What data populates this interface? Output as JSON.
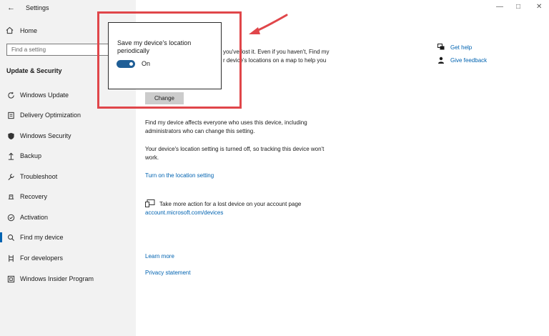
{
  "window": {
    "title": "Settings",
    "back_glyph": "←",
    "minimize_glyph": "—",
    "maximize_glyph": "□",
    "close_glyph": "✕"
  },
  "sidebar": {
    "home_label": "Home",
    "search_placeholder": "Find a setting",
    "section_title": "Update & Security",
    "items": [
      {
        "label": "Windows Update",
        "icon": "sync-icon"
      },
      {
        "label": "Delivery Optimization",
        "icon": "delivery-icon"
      },
      {
        "label": "Windows Security",
        "icon": "shield-icon"
      },
      {
        "label": "Backup",
        "icon": "backup-icon"
      },
      {
        "label": "Troubleshoot",
        "icon": "wrench-icon"
      },
      {
        "label": "Recovery",
        "icon": "recovery-icon"
      },
      {
        "label": "Activation",
        "icon": "activation-icon"
      },
      {
        "label": "Find my device",
        "icon": "find-device-icon",
        "active": true
      },
      {
        "label": "For developers",
        "icon": "developer-icon"
      },
      {
        "label": "Windows Insider Program",
        "icon": "insider-icon"
      }
    ]
  },
  "main": {
    "intro_line1": "you've lost it. Even if you haven't, Find my",
    "intro_line2": "r device's locations on a map to help you",
    "change_button": "Change",
    "affects_line1": "Find my device affects everyone who uses this device, including",
    "affects_line2": "administrators who can change this setting.",
    "location_line1": "Your device's location setting is turned off, so tracking this device won't",
    "location_line2": "work.",
    "turn_on_link": "Turn on the location setting",
    "account_action": "Take more action for a lost device on your account page",
    "account_link": "account.microsoft.com/devices",
    "learn_more": "Learn more",
    "privacy": "Privacy statement"
  },
  "help": {
    "get_help": "Get help",
    "give_feedback": "Give feedback"
  },
  "popup": {
    "label": "Save my device's location periodically",
    "toggle_state": "On",
    "toggle_on": true
  },
  "annotation": {
    "highlight_color": "#e0464a"
  },
  "colors": {
    "accent": "#0063b1",
    "toggle": "#1f5e96",
    "sidebar_bg": "#f2f2f2"
  }
}
